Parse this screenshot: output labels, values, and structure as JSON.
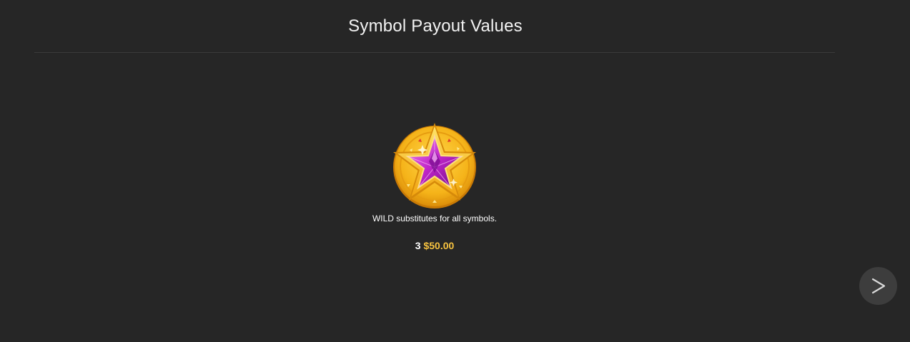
{
  "header": {
    "title": "Symbol Payout Values"
  },
  "symbol": {
    "icon": "wild-star-gem-icon",
    "description": "WILD substitutes for all symbols.",
    "payouts": [
      {
        "count": "3",
        "value": "$50.00"
      }
    ]
  },
  "navigation": {
    "next_icon": "chevron-right-icon"
  },
  "colors": {
    "background": "#262626",
    "payout_value": "#f7c340",
    "gem": "#b01fc0",
    "coin": "#f5b819",
    "nav_button": "#3d3d3d"
  }
}
